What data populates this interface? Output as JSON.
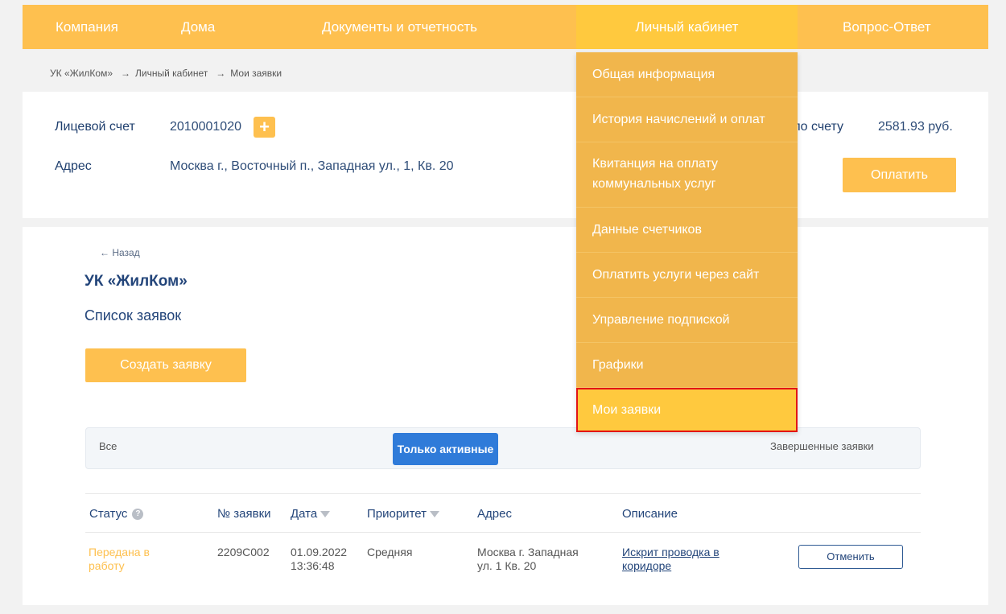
{
  "nav": {
    "items": [
      {
        "label": "Компания"
      },
      {
        "label": "Дома"
      },
      {
        "label": "Документы и отчетность"
      },
      {
        "label": "Личный кабинет"
      },
      {
        "label": "Вопрос-Ответ"
      }
    ]
  },
  "breadcrumb": {
    "items": [
      "УК «ЖилКом»",
      "Личный кабинет",
      "Мои заявки"
    ],
    "separator": "→"
  },
  "account": {
    "account_label": "Лицевой счет",
    "account_number": "2010001020",
    "add_icon": "plus-icon",
    "address_label": "Адрес",
    "address_value": "Москва г., Восточный п., Западная ул., 1, Кв. 20",
    "balance_label_partial": "по счету",
    "balance_value": "2581.93 руб.",
    "pay_button": "Оплатить"
  },
  "dropdown": {
    "items": [
      {
        "label": "Общая информация"
      },
      {
        "label": "История начислений и оплат"
      },
      {
        "label": "Квитанция на оплату коммунальных услуг"
      },
      {
        "label": "Данные счетчиков"
      },
      {
        "label": "Оплатить услуги через сайт"
      },
      {
        "label": "Управление подпиской"
      },
      {
        "label": "Графики"
      },
      {
        "label": "Мои заявки"
      }
    ],
    "selected": "Мои заявки"
  },
  "main": {
    "back_link": "← Назад",
    "org_title": "УК «ЖилКом»",
    "list_title": "Список заявок",
    "create_button": "Создать заявку",
    "filters": {
      "all": "Все",
      "active": "Только активные",
      "completed": "Завершенные заявки"
    },
    "table": {
      "headers": {
        "status": "Статус",
        "number": "№ заявки",
        "date": "Дата",
        "priority": "Приоритет",
        "address": "Адрес",
        "description": "Описание"
      },
      "rows": [
        {
          "status_line1": "Передана в",
          "status_line2": "работу",
          "number": "2209C002",
          "date_line1": "01.09.2022",
          "date_line2": "13:36:48",
          "priority": "Средняя",
          "address_line1": "Москва г. Западная",
          "address_line2": "ул. 1 Кв. 20",
          "description_line1": "Искрит проводка в",
          "description_line2": "коридоре",
          "cancel": "Отменить"
        }
      ]
    }
  },
  "colors": {
    "accent": "#fec04f",
    "primary_blue": "#2f7bd9",
    "text_dark": "#23457a",
    "highlight_border": "#e31414"
  }
}
